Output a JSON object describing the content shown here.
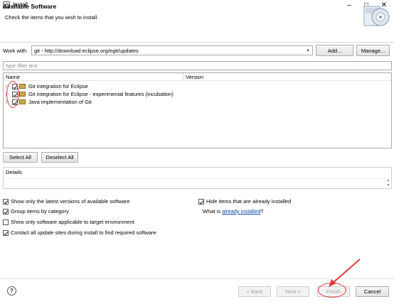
{
  "window": {
    "title": "Install",
    "minimize_glyph": "–",
    "maximize_glyph": "□",
    "close_glyph": "✕"
  },
  "header": {
    "title": "Available Software",
    "description": "Check the items that you wish to install."
  },
  "work_with": {
    "label": "Work with:",
    "value": "git - http://download.eclipse.org/egit/updates",
    "add_label": "Add...",
    "manage_label": "Manage..."
  },
  "filter": {
    "placeholder": "type filter text"
  },
  "tree": {
    "columns": [
      "Name",
      "Version"
    ],
    "rows": [
      {
        "label": "Git integration for Eclipse",
        "version": "",
        "checked": true
      },
      {
        "label": "Git integration for Eclipse - experimental features  (incubation)",
        "version": "",
        "checked": true
      },
      {
        "label": "Java implementation of Git",
        "version": "",
        "checked": true
      }
    ]
  },
  "selection_buttons": {
    "select_all": "Select All",
    "deselect_all": "Deselect All"
  },
  "details": {
    "label": "Details"
  },
  "options": {
    "latest": {
      "label": "Show only the latest versions of available software",
      "checked": true
    },
    "group": {
      "label": "Group items by category",
      "checked": true
    },
    "target": {
      "label": "Show only software applicable to target environment",
      "checked": false
    },
    "contact": {
      "label": "Contact all update sites during install to find required software",
      "checked": true
    },
    "hide": {
      "label": "Hide items that are already installed",
      "checked": true
    },
    "whatis_prefix": "What is ",
    "whatis_link": "already installed",
    "whatis_suffix": "?"
  },
  "footer": {
    "help": "?",
    "back": "< Back",
    "next": "Next >",
    "finish": "Finish",
    "cancel": "Cancel"
  },
  "colors": {
    "annotation": "#e03a3a",
    "link": "#0645ad"
  }
}
